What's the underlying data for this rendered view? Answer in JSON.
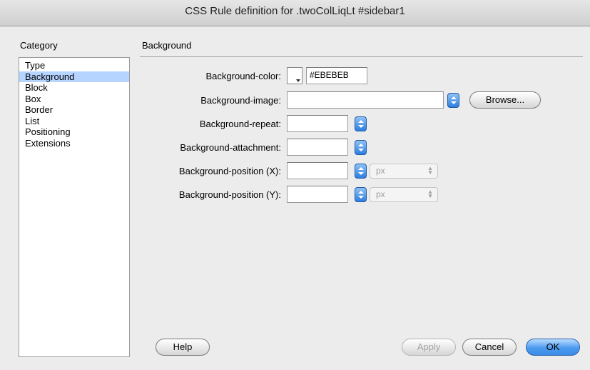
{
  "window": {
    "title": "CSS Rule definition for .twoColLiqLt #sidebar1"
  },
  "category": {
    "label": "Category",
    "items": [
      "Type",
      "Background",
      "Block",
      "Box",
      "Border",
      "List",
      "Positioning",
      "Extensions"
    ],
    "selected": "Background"
  },
  "panel": {
    "title": "Background",
    "fields": {
      "color_label": "Background-color:",
      "color_value": "#EBEBEB",
      "image_label": "Background-image:",
      "image_value": "",
      "browse_label": "Browse...",
      "repeat_label": "Background-repeat:",
      "repeat_value": "",
      "attachment_label": "Background-attachment:",
      "attachment_value": "",
      "posx_label": "Background-position (X):",
      "posx_value": "",
      "posx_unit": "px",
      "posy_label": "Background-position (Y):",
      "posy_value": "",
      "posy_unit": "px"
    }
  },
  "buttons": {
    "help": "Help",
    "apply": "Apply",
    "cancel": "Cancel",
    "ok": "OK"
  },
  "colors": {
    "selection": "#b5d4ff",
    "accent": "#3a8be6",
    "swatch": "#EBEBEB"
  }
}
